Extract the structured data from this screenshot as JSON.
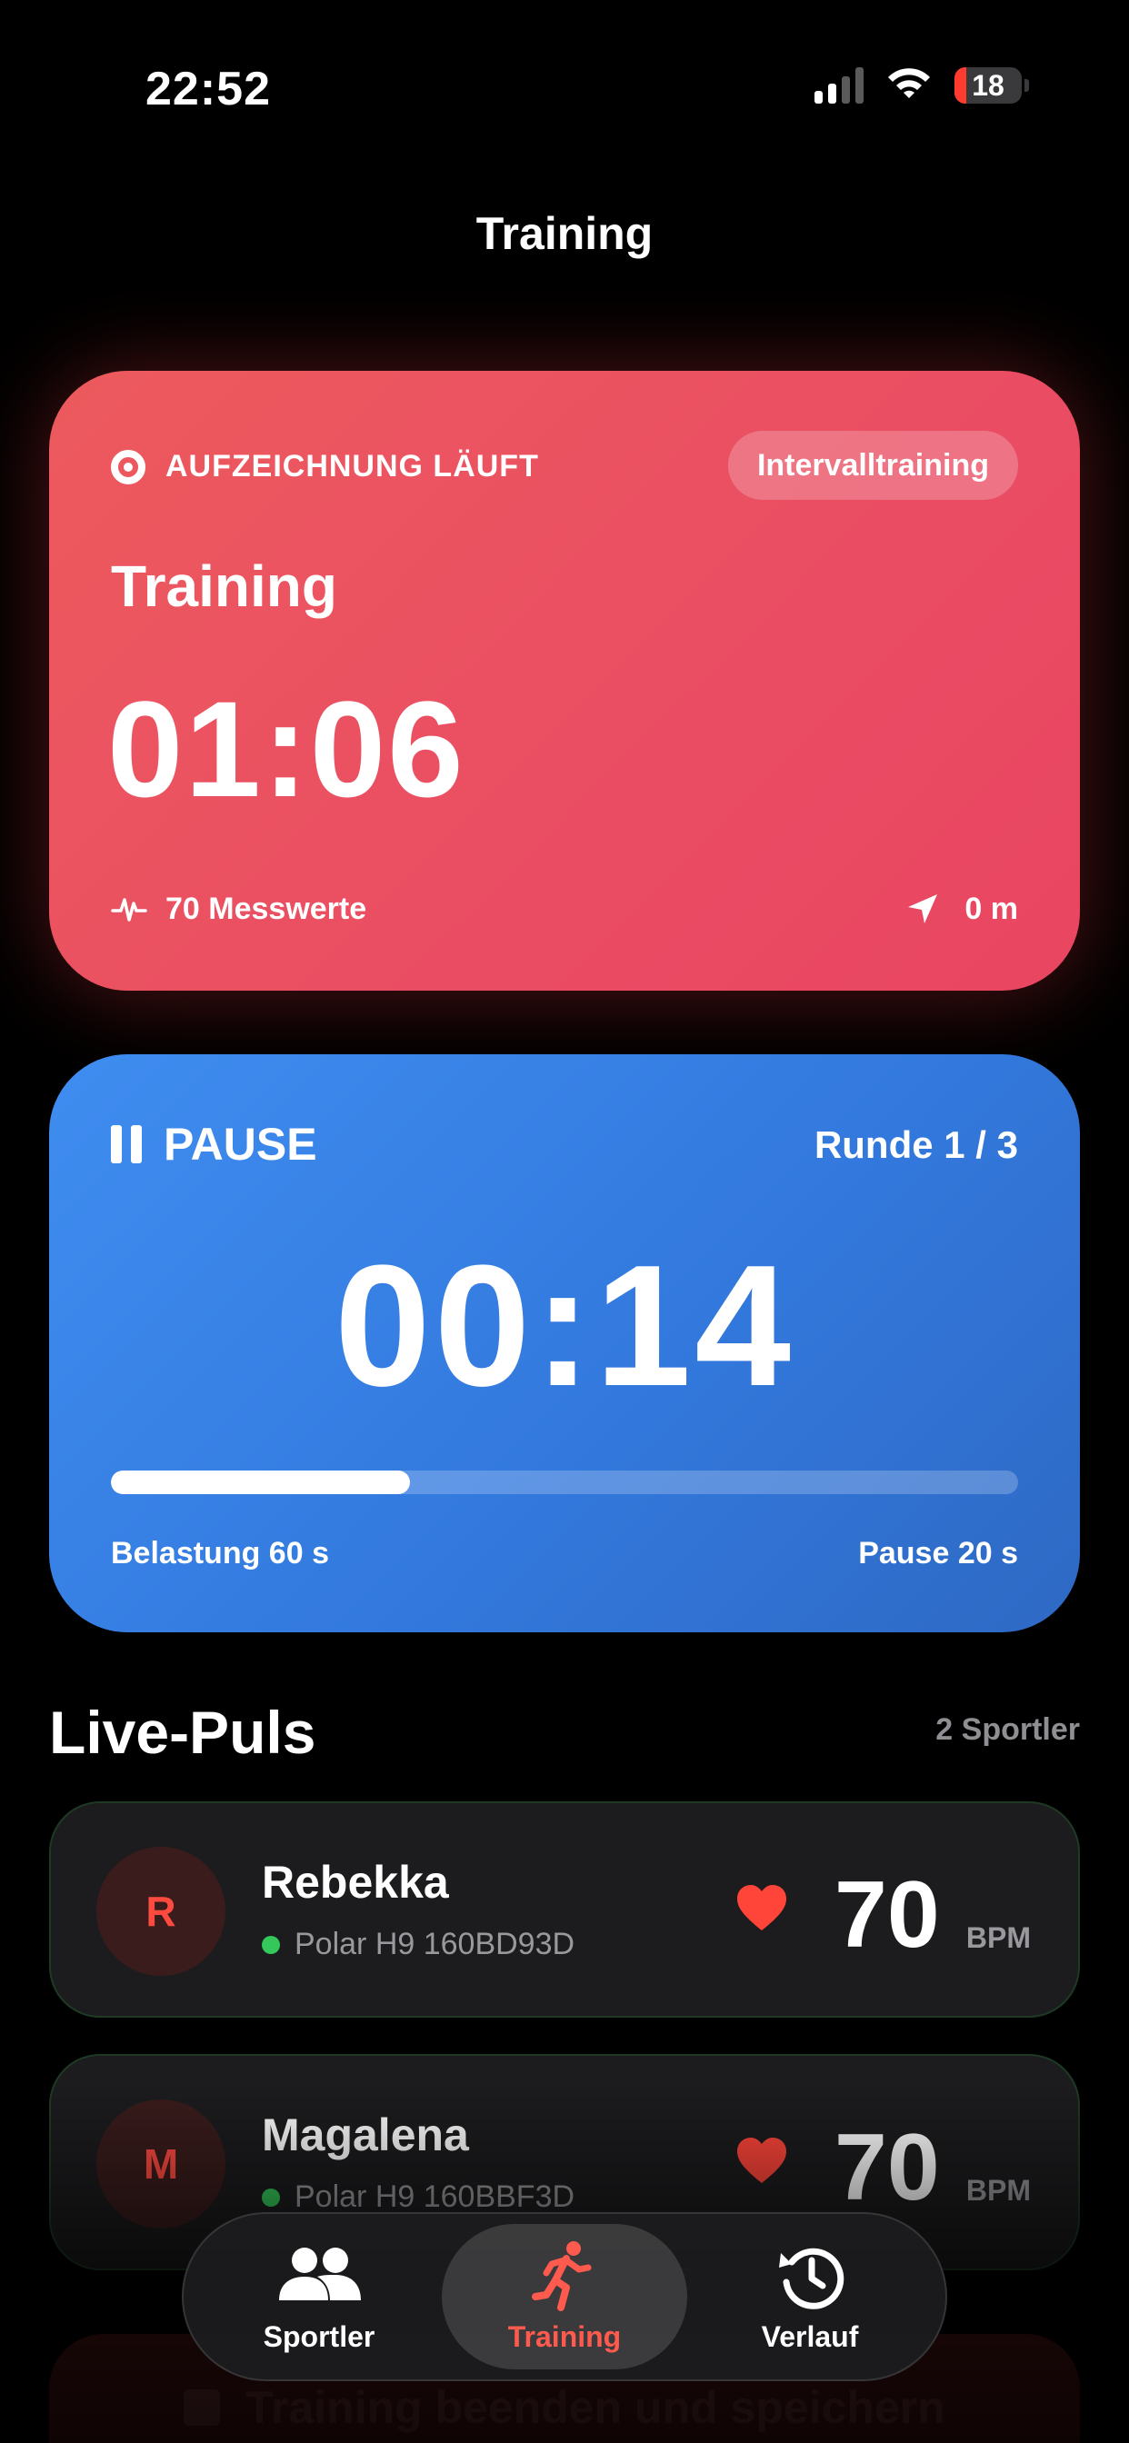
{
  "status_bar": {
    "time": "22:52",
    "battery": "18"
  },
  "nav": {
    "title": "Training"
  },
  "recording": {
    "status": "AUFZEICHNUNG LÄUFT",
    "mode": "Intervalltraining",
    "title": "Training",
    "elapsed": "01:06",
    "samples": "70 Messwerte",
    "distance": "0 m"
  },
  "interval": {
    "phase": "PAUSE",
    "round": "Runde 1 / 3",
    "remaining": "00:14",
    "progress_fraction": 0.33,
    "work_label": "Belastung 60 s",
    "rest_label": "Pause 20 s"
  },
  "live": {
    "title": "Live-Puls",
    "count": "2 Sportler",
    "athletes": [
      {
        "initial": "R",
        "name": "Rebekka",
        "device": "Polar H9 160BD93D",
        "bpm": "70",
        "unit": "BPM"
      },
      {
        "initial": "M",
        "name": "Magalena",
        "device": "Polar H9 160BBF3D",
        "bpm": "70",
        "unit": "BPM"
      }
    ]
  },
  "end_button": {
    "label": "Training beenden und speichern"
  },
  "tabs": [
    {
      "label": "Sportler"
    },
    {
      "label": "Training"
    },
    {
      "label": "Verlauf"
    }
  ],
  "colors": {
    "recording_card": "#EA4D63",
    "interval_card": "#3379DE",
    "accent": "#FF5A4E",
    "connected": "#34C759"
  }
}
